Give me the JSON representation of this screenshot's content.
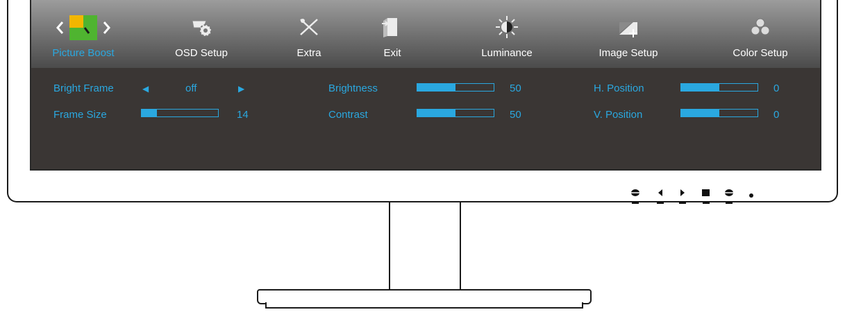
{
  "tabs": [
    {
      "label": "Picture Boost",
      "icon": "picture-boost-icon",
      "active": true
    },
    {
      "label": "OSD Setup",
      "icon": "osd-setup-icon"
    },
    {
      "label": "Extra",
      "icon": "extra-icon"
    },
    {
      "label": "Exit",
      "icon": "exit-icon"
    },
    {
      "label": "Luminance",
      "icon": "luminance-icon"
    },
    {
      "label": "Image Setup",
      "icon": "image-setup-icon"
    },
    {
      "label": "Color Setup",
      "icon": "color-setup-icon"
    }
  ],
  "settings": {
    "bright_frame": {
      "label": "Bright Frame",
      "value": "off"
    },
    "frame_size": {
      "label": "Frame Size",
      "value": "14",
      "level": 0.2
    },
    "brightness": {
      "label": "Brightness",
      "value": "50",
      "level": 0.5
    },
    "contrast": {
      "label": "Contrast",
      "value": "50",
      "level": 0.5
    },
    "h_position": {
      "label": "H. Position",
      "value": "0",
      "level": 0.5
    },
    "v_position": {
      "label": "V. Position",
      "value": "0",
      "level": 0.5
    }
  },
  "colors": {
    "accent": "#2aa8e0",
    "osd_bg": "#3a3634"
  }
}
